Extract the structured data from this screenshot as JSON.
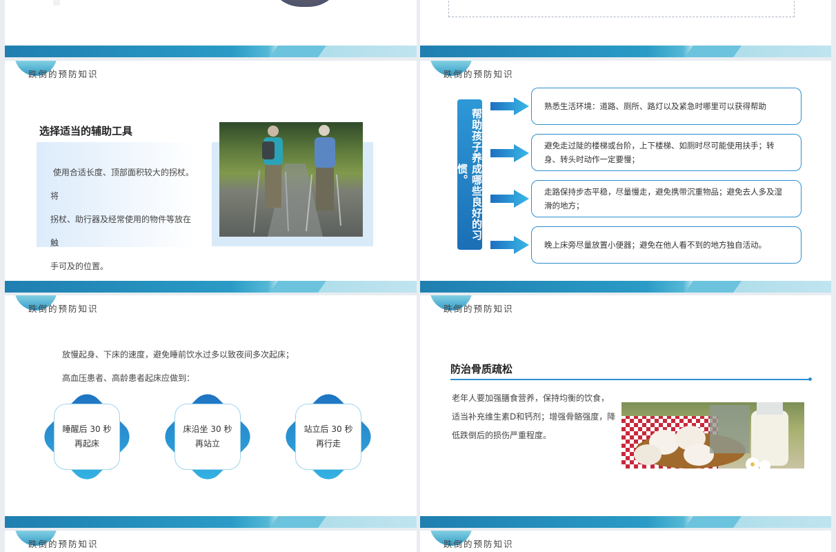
{
  "header_title": "跌倒的预防知识",
  "slide_tools": {
    "heading": "选择适当的辅助工具",
    "body": [
      "使用合适长度、顶部面积较大的拐杖。将",
      "拐杖、助行器及经常使用的物件等放在触",
      "手可及的位置。"
    ]
  },
  "slide_habits": {
    "vertical_title": "帮助孩子养成哪些良好的习惯。",
    "items": [
      "熟悉生活环境：道路、厕所、路灯以及紧急时哪里可以获得帮助",
      "避免走过陡的楼梯或台阶，上下楼梯、如厕时尽可能使用扶手；转身、转头时动作一定要慢；",
      "走路保持步态平稳，尽量慢走，避免携带沉重物品；避免去人多及湿滑的地方；",
      "晚上床旁尽量放置小便器；避免在他人看不到的地方独自活动。"
    ]
  },
  "slide_bed": {
    "lines": [
      "放慢起身、下床的速度，避免睡前饮水过多以致夜间多次起床；",
      "高血压患者、高龄患者起床应做到："
    ],
    "steps": [
      {
        "line1": "睡醒后 30 秒",
        "line2": "再起床"
      },
      {
        "line1": "床沿坐 30 秒",
        "line2": "再站立"
      },
      {
        "line1": "站立后 30 秒",
        "line2": "再行走"
      }
    ]
  },
  "slide_bone": {
    "heading": "防治骨质疏松",
    "body": [
      "老年人要加强膳食营养，保持均衡的饮食，",
      "适当补充维生素D和钙剂；增强骨骼强度，降",
      "低跌倒后的损伤严重程度。"
    ]
  },
  "colors": {
    "accent": "#2a8fd0",
    "band_dark": "#1f7fb0",
    "band_light": "#bfe4ef"
  }
}
